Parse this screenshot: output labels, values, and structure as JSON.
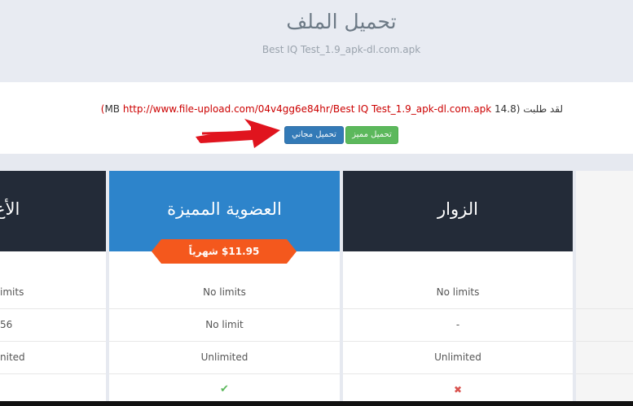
{
  "page": {
    "title": "تحميل الملف",
    "filename": "Best IQ Test_1.9_apk-dl.com.apk"
  },
  "request": {
    "prefix": "لقد طلبت",
    "link": "http://www.file-upload.com/04v4gg6e84hr/Best IQ Test_1.9_apk-dl.com.apk",
    "size": "(14.8 MB",
    "close": ")"
  },
  "buttons": {
    "premium": "تحميل مميز",
    "free": "تحميل مجاني"
  },
  "plans": {
    "left_partial": {
      "name": "الأع",
      "rows": [
        "imits",
        "56",
        "nited",
        ""
      ]
    },
    "premium": {
      "name": "العضوية المميزة",
      "price": "$11.95 شهرياً",
      "rows": [
        "No limits",
        "No limit",
        "Unlimited",
        "✔"
      ]
    },
    "visitor": {
      "name": "الزوار",
      "rows": [
        "No limits",
        "-",
        "Unlimited",
        "✖"
      ]
    }
  },
  "colors": {
    "header_dark": "#232b38",
    "premium_blue": "#2d84cb",
    "price_orange": "#f4581d",
    "check_green": "#5cb85c",
    "cross_red": "#d9534f"
  }
}
